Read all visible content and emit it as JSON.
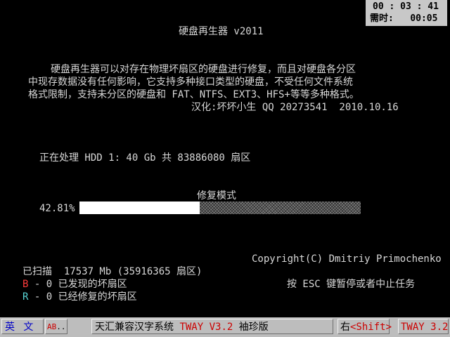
{
  "timer": {
    "clock": "00 : 03 : 41",
    "remaining_label": "需时:",
    "remaining_value": "00:05"
  },
  "title": "硬盘再生器 v2011",
  "description": {
    "line1": "硬盘再生器可以对存在物理坏扇区的硬盘进行修复，而且对硬盘各分区",
    "line2": "中现存数据没有任何影响，它支持多种接口类型的硬盘，不受任何文件系统",
    "line3": "格式限制，支持未分区的硬盘和 FAT、NTFS、EXT3、HFS+等等多种格式。",
    "credit": "汉化:坏坏小生 QQ 20273541  2010.10.16"
  },
  "processing": "正在处理 HDD 1: 40 Gb 共 83886080 扇区",
  "mode": "修复模式",
  "progress": {
    "percent_label": "42.81%",
    "fraction": 0.4281
  },
  "copyright": "Copyright(C) Dmitriy Primochenko",
  "scanned": "已扫描  17537 Mb (35916365 扇区)",
  "found": {
    "key": "B",
    "text": " - 0 已发现的坏扇区"
  },
  "repaired": {
    "key": "R",
    "text": " - 0 已经修复的坏扇区"
  },
  "hint": "按 ESC 键暂停或者中止任务",
  "statusbar": {
    "ime": "英 文",
    "ab_prefix": "AB",
    "ab_suffix": "..",
    "title_prefix": "天汇兼容汉字系统 ",
    "title_brand": "TWAY V3.2",
    "title_suffix": " 袖珍版",
    "shift_prefix": "右",
    "shift_key": "<Shift>",
    "version": "TWAY 3.2"
  }
}
